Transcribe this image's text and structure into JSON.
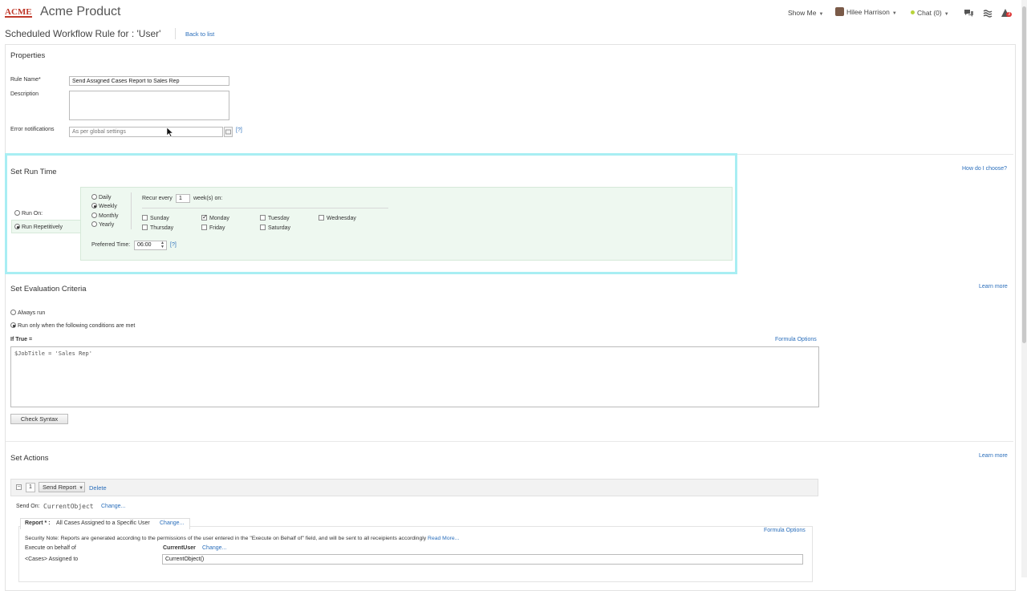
{
  "header": {
    "logo_text": "ACME",
    "app_title": "Acme Product",
    "show_me": "Show Me",
    "user_name": "Hilee Harrison",
    "chat": "Chat (0)",
    "notif_count": "3"
  },
  "page": {
    "title": "Scheduled Workflow Rule for : 'User'",
    "back_link": "Back to list"
  },
  "properties": {
    "title": "Properties",
    "rule_name_label": "Rule Name",
    "required_mark": "*",
    "rule_name_value": "Send Assigned Cases Report to Sales Rep",
    "description_label": "Description",
    "description_value": "",
    "error_label": "Error notifications",
    "error_value": "As per global settings",
    "help": "[?]"
  },
  "run_time": {
    "title": "Set Run Time",
    "how_link": "How do I choose?",
    "run_on": "Run On:",
    "run_repetitively": "Run Repetitively",
    "frequencies": [
      "Daily",
      "Weekly",
      "Monthly",
      "Yearly"
    ],
    "recur_prefix": "Recur every",
    "recur_value": "1",
    "recur_suffix": "week(s) on:",
    "days": [
      "Sunday",
      "Monday",
      "Tuesday",
      "Wednesday",
      "Thursday",
      "Friday",
      "Saturday"
    ],
    "preferred_label": "Preferred Time:",
    "preferred_value": "06:00",
    "help": "[?]"
  },
  "evaluation": {
    "title": "Set Evaluation Criteria",
    "learn_more": "Learn more",
    "always_run": "Always run",
    "run_only": "Run only when the following conditions are met",
    "if_true": "If True =",
    "formula_options": "Formula Options",
    "formula": "$JobTitle = 'Sales Rep'",
    "check_syntax": "Check Syntax"
  },
  "actions": {
    "title": "Set Actions",
    "learn_more": "Learn more",
    "index": "1",
    "action_type": "Send Report",
    "delete": "Delete",
    "send_on_label": "Send On:",
    "send_on_value": "CurrentObject",
    "change": "Change...",
    "report_label": "Report",
    "report_value": "All Cases Assigned to a Specific User",
    "formula_options": "Formula Options",
    "security_note": "Security Note: Reports are generated according to the permissions of the user entered in the \"Execute on Behalf of\" field, and will be sent to all receipients accordingly",
    "read_more": "Read More...",
    "execute_label": "Execute on behalf of",
    "execute_value": "CurrentUser",
    "assigned_label": "<Cases> Assigned to",
    "assigned_value": "CurrentObject()"
  },
  "colors": {
    "link": "#2a6ebb",
    "highlight": "#a8eef3",
    "green_panel": "#eef8f0"
  }
}
